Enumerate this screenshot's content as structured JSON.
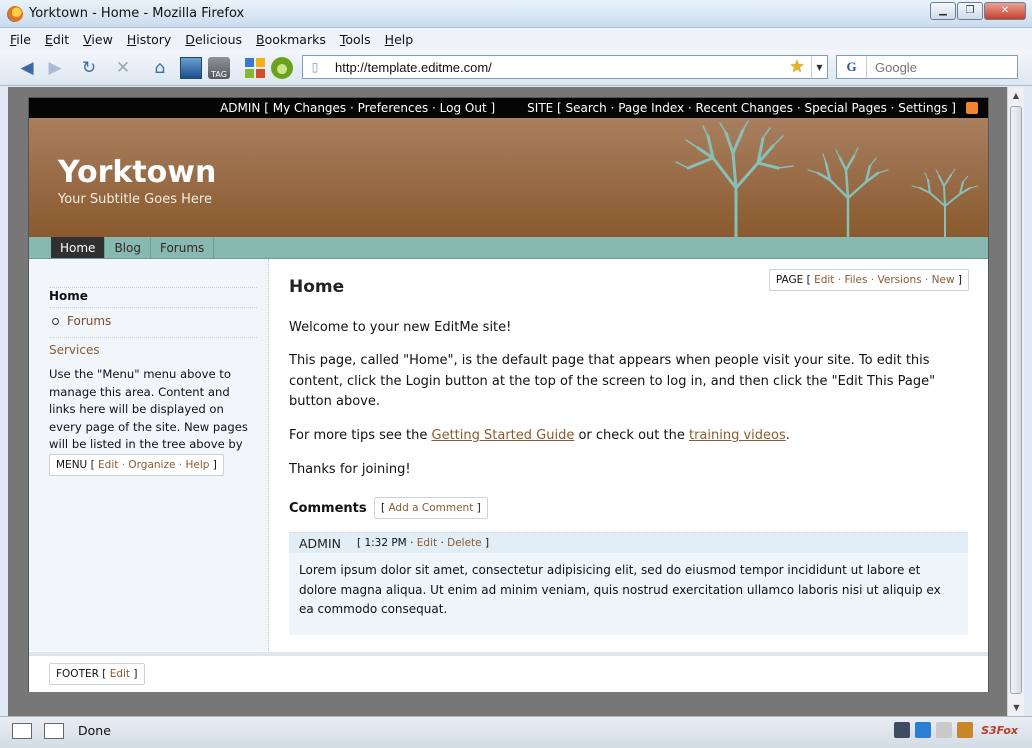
{
  "window": {
    "title": "Yorktown - Home - Mozilla Firefox"
  },
  "menubar": {
    "items": [
      {
        "label": "File",
        "key": "F",
        "rest": "ile"
      },
      {
        "label": "Edit",
        "key": "E",
        "rest": "dit"
      },
      {
        "label": "View",
        "key": "V",
        "rest": "iew"
      },
      {
        "label": "History",
        "key": "H",
        "rest": "istory"
      },
      {
        "label": "Delicious",
        "key": "D",
        "rest": "elicious"
      },
      {
        "label": "Bookmarks",
        "key": "B",
        "rest": "ookmarks"
      },
      {
        "label": "Tools",
        "key": "T",
        "rest": "ools"
      },
      {
        "label": "Help",
        "key": "H",
        "rest": "elp"
      }
    ]
  },
  "toolbar": {
    "tag_label": "TAG"
  },
  "address": {
    "url": "http://template.editme.com/"
  },
  "search": {
    "placeholder": "Google"
  },
  "site": {
    "admin_bar": {
      "admin": "ADMIN [ My Changes · Preferences · Log Out ]",
      "site": "SITE [ Search · Page Index · Recent Changes · Special Pages · Settings ]"
    },
    "title": "Yorktown",
    "subtitle": "Your Subtitle Goes Here",
    "tabs": [
      "Home",
      "Blog",
      "Forums"
    ],
    "sidebar": {
      "home": "Home",
      "forums": "Forums",
      "services": "Services",
      "text": "Use the \"Menu\" menu above to manage this area. Content and links here will be displayed on every page of the site. New pages will be listed in the tree above by default.",
      "menu_box": {
        "prefix": "MENU [",
        "links": [
          "Edit",
          "Organize",
          "Help"
        ],
        "suffix": "]"
      }
    },
    "main": {
      "title": "Home",
      "page_box": {
        "prefix": "PAGE [",
        "links": [
          "Edit",
          "Files",
          "Versions",
          "New"
        ],
        "suffix": "]"
      },
      "welcome": "Welcome to your new EditMe site!",
      "para1": "This page, called \"Home\", is the default page that appears when people visit your site. To edit this content, click the Login button at the top of the screen to log in, and then click the \"Edit This Page\" button above.",
      "tips_prefix": "For more tips see the ",
      "tips_link1": "Getting Started Guide",
      "tips_mid": " or check out the ",
      "tips_link2": "training videos",
      "tips_suffix": ".",
      "thanks": "Thanks for joining!",
      "comments_title": "Comments",
      "add_comment": "Add a Comment",
      "comment": {
        "author": "ADMIN",
        "time": "1:32 PM",
        "edit": "Edit",
        "delete": "Delete",
        "body": "Lorem ipsum dolor sit amet, consectetur adipisicing elit, sed do eiusmod tempor incididunt ut labore et dolore magna aliqua. Ut enim ad minim veniam, quis nostrud exercitation ullamco laboris nisi ut aliquip ex ea commodo consequat."
      }
    },
    "footer": {
      "prefix": "FOOTER [",
      "link": "Edit",
      "suffix": "]"
    }
  },
  "status": {
    "text": "Done",
    "addon": "S3Fox"
  },
  "colors": {
    "accent": "#8a5a2f",
    "header_brown": "#9b6b43",
    "tab_teal": "#88b9b1"
  }
}
